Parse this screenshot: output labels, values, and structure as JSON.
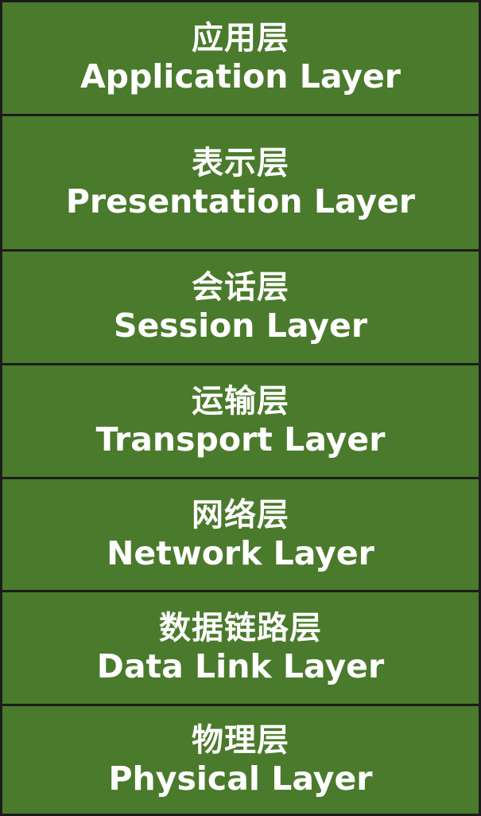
{
  "layers": [
    {
      "zh": "应用层",
      "en": "Application Layer"
    },
    {
      "zh": "表示层",
      "en": "Presentation Layer"
    },
    {
      "zh": "会话层",
      "en": "Session Layer"
    },
    {
      "zh": "运输层",
      "en": "Transport Layer"
    },
    {
      "zh": "网络层",
      "en": "Network Layer"
    },
    {
      "zh": "数据链路层",
      "en": "Data Link Layer"
    },
    {
      "zh": "物理层",
      "en": "Physical Layer"
    }
  ],
  "colors": {
    "box_fill": "#4a7a2b",
    "border": "#1c1c1c",
    "text": "#ffffff"
  }
}
